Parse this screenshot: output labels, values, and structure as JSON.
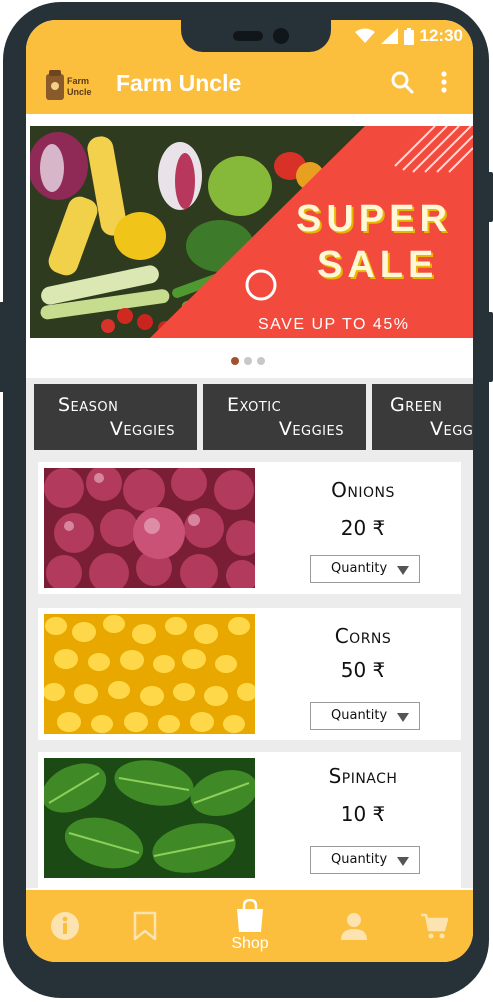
{
  "status_bar": {
    "time": "12:30"
  },
  "app_bar": {
    "title": "Farm Uncle",
    "logo_text_line1": "Farm",
    "logo_text_line2": "Uncle"
  },
  "banner": {
    "headline_1": "SUPER",
    "headline_2": "SALE",
    "subtext": "SAVE UP TO 45%",
    "slides": 3,
    "active_slide": 1
  },
  "categories": [
    {
      "line1": "Season",
      "line2": "Veggies"
    },
    {
      "line1": "Exotic",
      "line2": "Veggies"
    },
    {
      "line1": "Green",
      "line2": "Veggi"
    }
  ],
  "products": [
    {
      "name": "Onions",
      "price": "20 ₹",
      "quantity_label": "Quantity",
      "image": "onions-photo"
    },
    {
      "name": "Corns",
      "price": "50 ₹",
      "quantity_label": "Quantity",
      "image": "corn-photo"
    },
    {
      "name": "Spinach",
      "price": "10 ₹",
      "quantity_label": "Quantity",
      "image": "spinach-photo"
    }
  ],
  "bottom_nav": {
    "items": [
      {
        "icon": "info-icon",
        "label": ""
      },
      {
        "icon": "bookmark-icon",
        "label": ""
      },
      {
        "icon": "shopping-bag-icon",
        "label": "Shop"
      },
      {
        "icon": "person-icon",
        "label": ""
      },
      {
        "icon": "cart-icon",
        "label": ""
      }
    ],
    "active_index": 2
  },
  "colors": {
    "primary": "#fbbe3d",
    "frame": "#263238",
    "category_bg": "#3a3a3a",
    "sale_red": "#f24a3c"
  }
}
